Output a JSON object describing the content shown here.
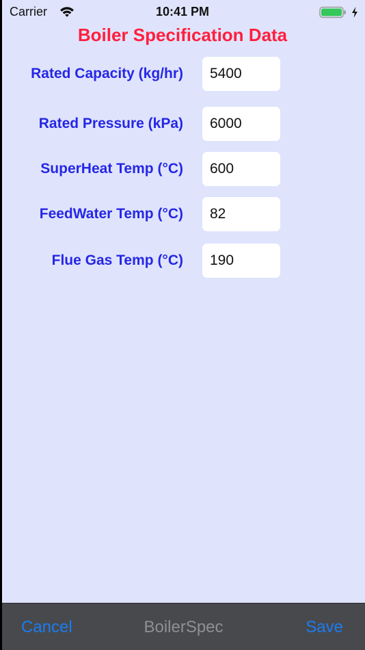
{
  "status_bar": {
    "carrier": "Carrier",
    "time": "10:41 PM",
    "wifi_icon": "wifi-icon",
    "battery_icon": "battery-icon",
    "charging_icon": "charging-bolt-icon",
    "battery_level": 1.0,
    "battery_color": "#34c759"
  },
  "title": {
    "text": "Boiler Specification Data",
    "color": "#ff1f3d"
  },
  "label_color": "#2626e6",
  "fields": [
    {
      "label": "Rated Capacity (kg/hr)",
      "value": "5400"
    },
    {
      "label": "Rated Pressure (kPa)",
      "value": "6000"
    },
    {
      "label": "SuperHeat Temp (°C)",
      "value": "600"
    },
    {
      "label": "FeedWater Temp (°C)",
      "value": "82"
    },
    {
      "label": "Flue Gas Temp (°C)",
      "value": "190"
    }
  ],
  "toolbar": {
    "cancel_label": "Cancel",
    "title": "BoilerSpec",
    "save_label": "Save",
    "accent_color": "#1a7cf0"
  },
  "background_color": "#dfe4fc"
}
